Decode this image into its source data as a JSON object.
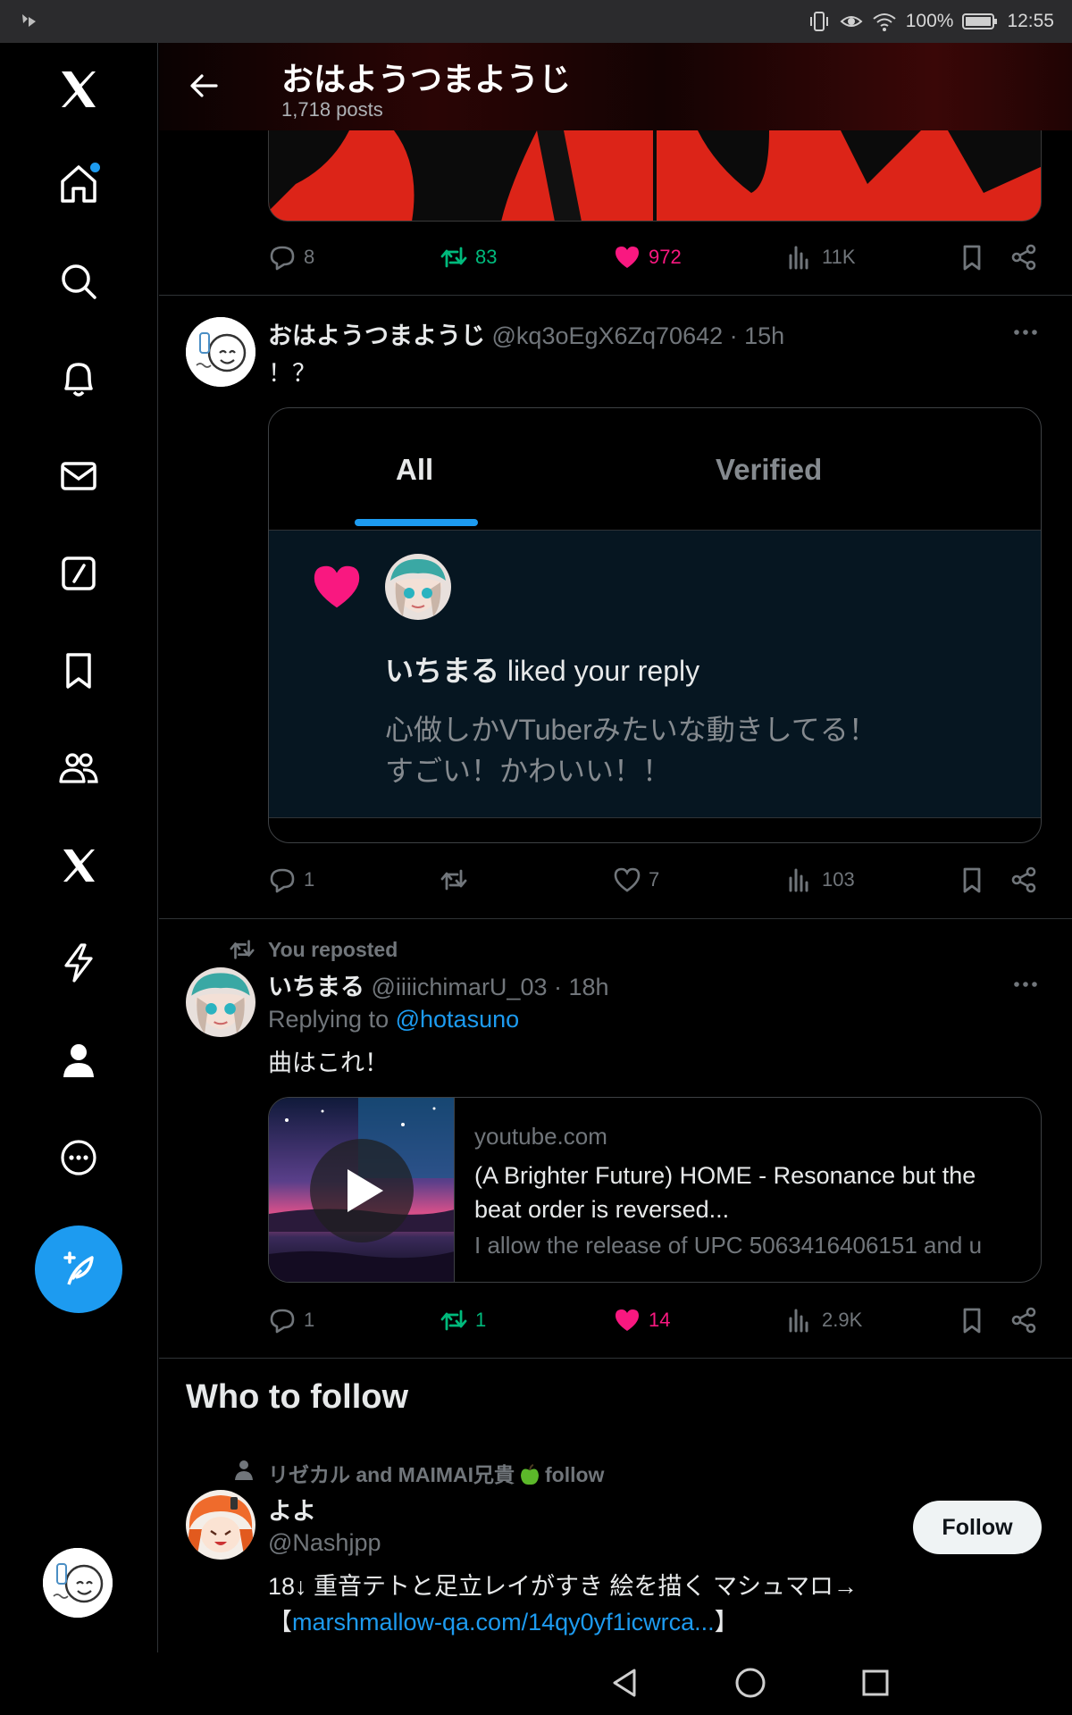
{
  "status_bar": {
    "battery": "100%",
    "time": "12:55"
  },
  "header": {
    "title": "おはようつまようじ",
    "posts_count": "1,718 posts"
  },
  "post1": {
    "reply_count": "8",
    "repost_count": "83",
    "like_count": "972",
    "view_count": "11K"
  },
  "post2": {
    "name": "おはようつまようじ",
    "handle_time": "@kq3oEgX6Zq70642 · 15h",
    "text": "！？",
    "embed": {
      "tabs": [
        "All",
        "Verified"
      ],
      "notif_user": "いちまる",
      "notif_action": "liked your reply",
      "quote_line1": "心做しかVTuberみたいな動きしてる！",
      "quote_line2": "すごい！かわいい！！"
    },
    "reply_count": "1",
    "like_count": "7",
    "view_count": "103"
  },
  "post3": {
    "repost_label": "You reposted",
    "name": "いちまる",
    "handle_time": "@iiiichimarU_03 · 18h",
    "replying_prefix": "Replying to",
    "replying_user": "@hotasuno",
    "text": "曲はこれ！",
    "card": {
      "domain": "youtube.com",
      "title": "(A Brighter Future) HOME - Resonance but the beat order is reversed...",
      "description": "I allow the release of UPC 5063416406151 and u"
    },
    "reply_count": "1",
    "repost_count": "1",
    "like_count": "14",
    "view_count": "2.9K"
  },
  "who_to_follow": {
    "title": "Who to follow",
    "social_context_prefix": "リゼカル and MAIMAI兄貴",
    "social_context_suffix": "follow",
    "name": "よよ",
    "handle": "@Nashjpp",
    "follow_label": "Follow",
    "bio_line1": "18↓ 重音テトと足立レイがすき 絵を描く マシュマロ→",
    "bio_open": "【",
    "bio_link": "marshmallow-qa.com/14qy0yf1icwrca...",
    "bio_close": "】"
  },
  "colors": {
    "accent": "#1d9bf0",
    "like": "#f91880",
    "repost": "#00ba7c",
    "muted": "#71767b"
  },
  "icons": [
    "x-logo-icon",
    "home-icon",
    "search-icon",
    "bell-icon",
    "mail-icon",
    "grok-icon",
    "bookmark-icon",
    "communities-icon",
    "premium-icon",
    "lightning-icon",
    "profile-icon",
    "more-icon",
    "compose-icon",
    "back-arrow-icon",
    "reply-icon",
    "repost-icon",
    "heart-icon",
    "views-icon",
    "share-icon"
  ]
}
